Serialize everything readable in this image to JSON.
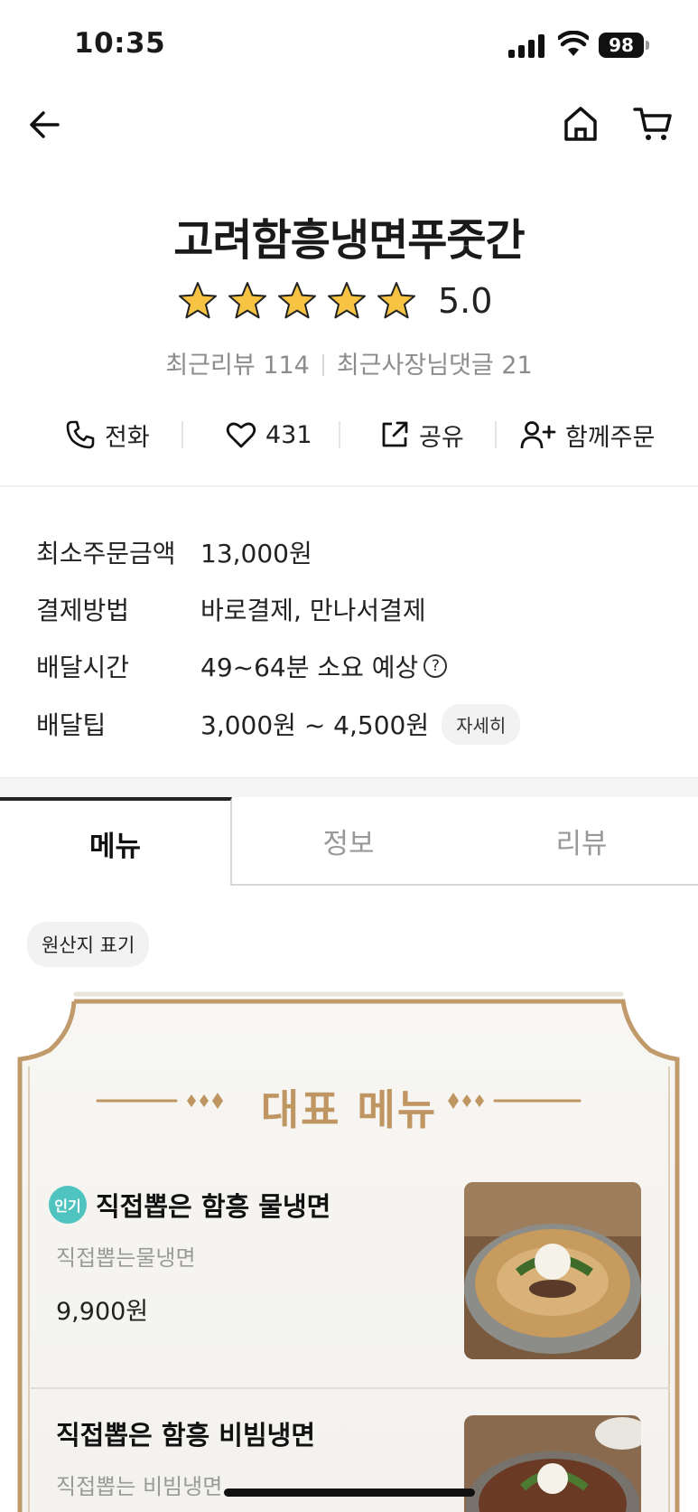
{
  "status_bar": {
    "time": "10:35",
    "battery": "98"
  },
  "nav": {
    "back_icon": "arrow-left-icon",
    "home_icon": "home-icon",
    "cart_icon": "cart-icon"
  },
  "store": {
    "name": "고려함흥냉면푸줏간",
    "rating": "5.0",
    "stars": 5,
    "recent_reviews": "최근리뷰 114",
    "recent_owner_replies": "최근사장님댓글 21"
  },
  "actions": {
    "call": "전화",
    "likes": "431",
    "share": "공유",
    "group_order": "함께주문"
  },
  "info": {
    "min_order_label": "최소주문금액",
    "min_order_value": "13,000원",
    "payment_label": "결제방법",
    "payment_value": "바로결제, 만나서결제",
    "delivery_time_label": "배달시간",
    "delivery_time_value": "49~64분 소요 예상",
    "delivery_tip_label": "배달팁",
    "delivery_tip_value": "3,000원 ~ 4,500원",
    "detail_button": "자세히",
    "help_glyph": "?"
  },
  "tabs": {
    "menu": "메뉴",
    "info": "정보",
    "review": "리뷰"
  },
  "origin_label": "원산지 표기",
  "featured": {
    "title": "대표 메뉴",
    "accent_color": "#bf9561",
    "items": [
      {
        "badge": "인기",
        "name": "직접뽑은 함흥 물냉면",
        "desc": "직접뽑는물냉면",
        "price": "9,900원"
      },
      {
        "name": "직접뽑은 함흥 비빔냉면",
        "desc": "직접뽑는 비빔냉면"
      }
    ]
  }
}
